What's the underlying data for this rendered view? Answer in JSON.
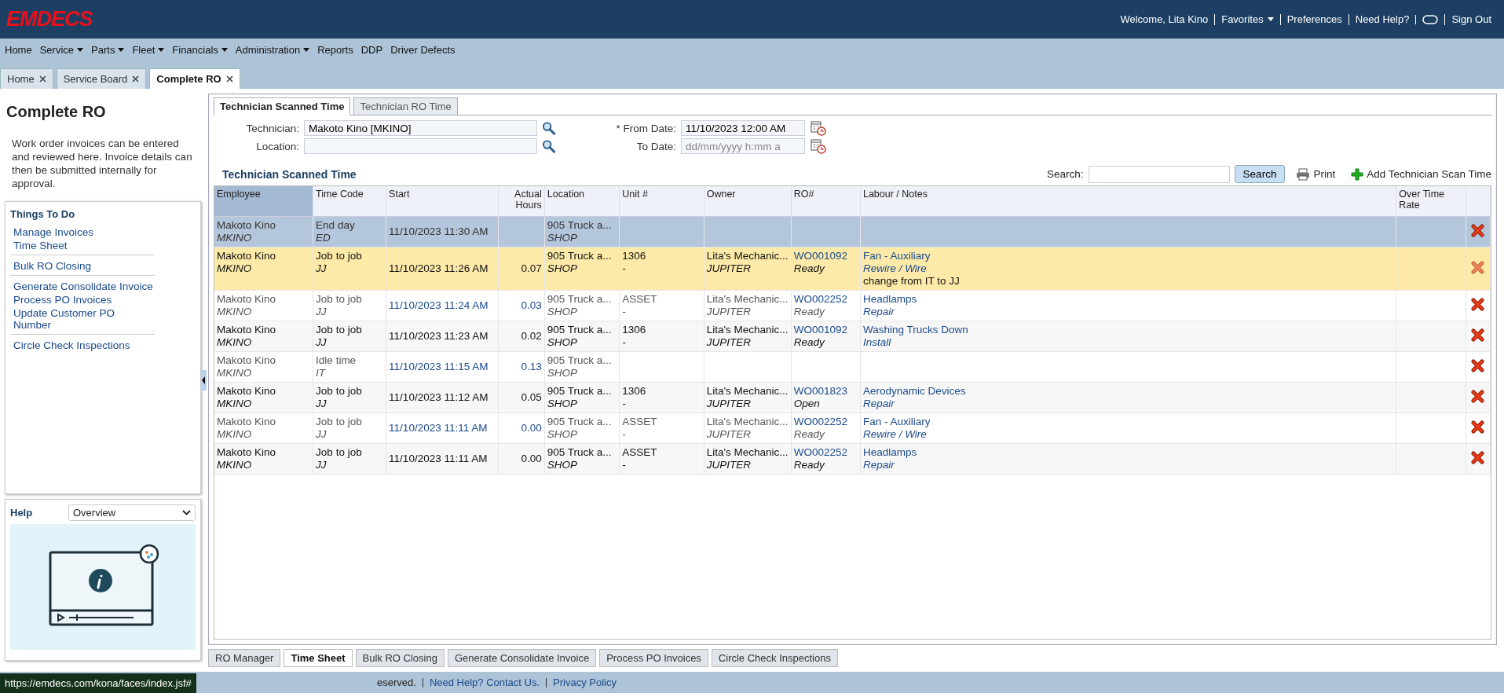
{
  "header": {
    "logo": "EMDECS",
    "welcome": "Welcome, Lita Kino",
    "links": [
      {
        "label": "Favorites",
        "has_dropdown": true
      },
      {
        "label": "Preferences",
        "has_dropdown": false
      },
      {
        "label": "Need Help?",
        "has_dropdown": false
      }
    ],
    "sign_out": "Sign Out"
  },
  "menu": [
    {
      "label": "Home",
      "has_dropdown": false
    },
    {
      "label": "Service",
      "has_dropdown": true
    },
    {
      "label": "Parts",
      "has_dropdown": true
    },
    {
      "label": "Fleet",
      "has_dropdown": true
    },
    {
      "label": "Financials",
      "has_dropdown": true
    },
    {
      "label": "Administration",
      "has_dropdown": true
    },
    {
      "label": "Reports",
      "has_dropdown": false
    },
    {
      "label": "DDP",
      "has_dropdown": false
    },
    {
      "label": "Driver Defects",
      "has_dropdown": false
    }
  ],
  "page_tabs": [
    {
      "label": "Home",
      "selected": false
    },
    {
      "label": "Service Board",
      "selected": false
    },
    {
      "label": "Complete RO",
      "selected": true
    }
  ],
  "sidebar": {
    "title": "Complete RO",
    "description": "Work order invoices can be entered and reviewed here. Invoice details can then be submitted internally for approval.",
    "things_to_do": {
      "title": "Things To Do",
      "groups": [
        [
          "Manage Invoices",
          "Time Sheet"
        ],
        [
          "Bulk RO Closing"
        ],
        [
          "Generate Consolidate Invoice",
          "Process PO Invoices",
          "Update Customer PO Number"
        ],
        [
          "Circle Check Inspections"
        ]
      ]
    },
    "help": {
      "title": "Help",
      "select": "Overview"
    }
  },
  "inner_tabs": [
    {
      "label": "Technician Scanned Time",
      "selected": true
    },
    {
      "label": "Technician RO Time",
      "selected": false
    }
  ],
  "filters": {
    "technician": {
      "label": "Technician:",
      "value": "Makoto Kino [MKINO]"
    },
    "location": {
      "label": "Location:"
    },
    "from_date": {
      "required": "*",
      "label": "From Date:",
      "value": "11/10/2023 12:00 AM"
    },
    "to_date": {
      "label": "To Date:",
      "placeholder": "dd/mm/yyyy h:mm a"
    }
  },
  "section_title": "Technician Scanned Time",
  "search": {
    "label": "Search:",
    "button": "Search"
  },
  "print": "Print",
  "add": "Add Technician Scan Time",
  "table": {
    "columns": [
      "Employee",
      "Time Code",
      "Start",
      "Actual Hours",
      "Location",
      "Unit #",
      "Owner",
      "RO#",
      "Labour / Notes",
      "Over Time Rate"
    ],
    "rows": [
      {
        "selected": true,
        "highlighted": false,
        "employee": "Makoto Kino",
        "employee_code": "MKINO",
        "time_code": "End day",
        "time_code_abbr": "ED",
        "start": "11/10/2023 11:30 AM",
        "location": "905 Truck a...",
        "location_code": "SHOP"
      },
      {
        "selected": false,
        "highlighted": true,
        "employee": "Makoto Kino",
        "employee_code": "MKINO",
        "time_code": "Job to job",
        "time_code_abbr": "JJ",
        "start": "11/10/2023 11:26 AM",
        "hours": "0.07",
        "location": "905 Truck a...",
        "location_code": "SHOP",
        "unit": "1306",
        "unit_sub": "-",
        "owner": "Lita's Mechanic...",
        "owner_code": "JUPITER",
        "ro": "WO001092",
        "ro_status": "Ready",
        "labour": "Fan - Auxiliary",
        "labour_op": "Rewire / Wire",
        "note": "change from IT to JJ"
      },
      {
        "selected": false,
        "highlighted": false,
        "employee": "Makoto Kino",
        "employee_code": "MKINO",
        "time_code": "Job to job",
        "time_code_abbr": "JJ",
        "start": "11/10/2023 11:24 AM",
        "hours": "0.03",
        "location": "905 Truck a...",
        "location_code": "SHOP",
        "unit": "ASSET",
        "unit_sub": "-",
        "owner": "Lita's Mechanic...",
        "owner_code": "JUPITER",
        "ro": "WO002252",
        "ro_status": "Ready",
        "labour": "Headlamps",
        "labour_op": "Repair"
      },
      {
        "selected": false,
        "highlighted": false,
        "employee": "Makoto Kino",
        "employee_code": "MKINO",
        "time_code": "Job to job",
        "time_code_abbr": "JJ",
        "start": "11/10/2023 11:23 AM",
        "hours": "0.02",
        "location": "905 Truck a...",
        "location_code": "SHOP",
        "unit": "1306",
        "unit_sub": "-",
        "owner": "Lita's Mechanic...",
        "owner_code": "JUPITER",
        "ro": "WO001092",
        "ro_status": "Ready",
        "labour": "Washing Trucks Down",
        "labour_op": "Install"
      },
      {
        "selected": false,
        "highlighted": false,
        "employee": "Makoto Kino",
        "employee_code": "MKINO",
        "time_code": "Idle time",
        "time_code_abbr": "IT",
        "start": "11/10/2023 11:15 AM",
        "hours": "0.13",
        "location": "905 Truck a...",
        "location_code": "SHOP"
      },
      {
        "selected": false,
        "highlighted": false,
        "employee": "Makoto Kino",
        "employee_code": "MKINO",
        "time_code": "Job to job",
        "time_code_abbr": "JJ",
        "start": "11/10/2023 11:12 AM",
        "hours": "0.05",
        "location": "905 Truck a...",
        "location_code": "SHOP",
        "unit": "1306",
        "unit_sub": "-",
        "owner": "Lita's Mechanic...",
        "owner_code": "JUPITER",
        "ro": "WO001823",
        "ro_status": "Open",
        "labour": "Aerodynamic Devices",
        "labour_op": "Repair"
      },
      {
        "selected": false,
        "highlighted": false,
        "employee": "Makoto Kino",
        "employee_code": "MKINO",
        "time_code": "Job to job",
        "time_code_abbr": "JJ",
        "start": "11/10/2023 11:11 AM",
        "hours": "0.00",
        "location": "905 Truck a...",
        "location_code": "SHOP",
        "unit": "ASSET",
        "unit_sub": "-",
        "owner": "Lita's Mechanic...",
        "owner_code": "JUPITER",
        "ro": "WO002252",
        "ro_status": "Ready",
        "labour": "Fan - Auxiliary",
        "labour_op": "Rewire / Wire"
      },
      {
        "selected": false,
        "highlighted": false,
        "employee": "Makoto Kino",
        "employee_code": "MKINO",
        "time_code": "Job to job",
        "time_code_abbr": "JJ",
        "start": "11/10/2023 11:11 AM",
        "hours": "0.00",
        "location": "905 Truck a...",
        "location_code": "SHOP",
        "unit": "ASSET",
        "unit_sub": "-",
        "owner": "Lita's Mechanic...",
        "owner_code": "JUPITER",
        "ro": "WO002252",
        "ro_status": "Ready",
        "labour": "Headlamps",
        "labour_op": "Repair"
      }
    ]
  },
  "bottom_tabs": [
    {
      "label": "RO Manager",
      "selected": false
    },
    {
      "label": "Time Sheet",
      "selected": true
    },
    {
      "label": "Bulk RO Closing",
      "selected": false
    },
    {
      "label": "Generate Consolidate Invoice",
      "selected": false
    },
    {
      "label": "Process PO Invoices",
      "selected": false
    },
    {
      "label": "Circle Check Inspections",
      "selected": false
    }
  ],
  "footer": {
    "copyright": "eserved.",
    "links": [
      "Need Help? Contact Us.",
      "Privacy Policy"
    ]
  },
  "status_url": "https://emdecs.com/kona/faces/index.jsf#"
}
